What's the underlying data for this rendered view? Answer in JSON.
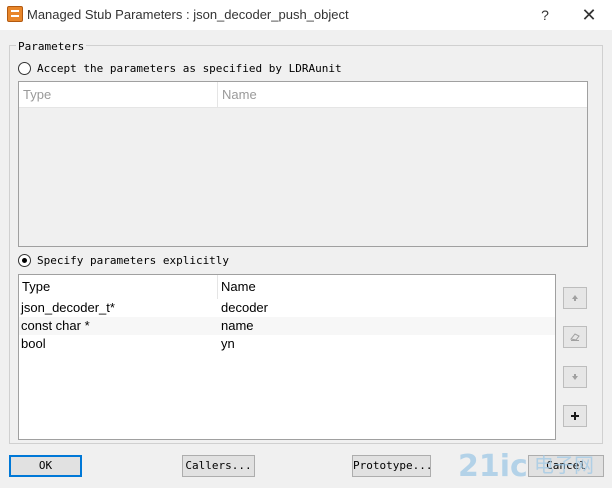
{
  "window": {
    "title": "Managed Stub Parameters : json_decoder_push_object",
    "help_label": "?",
    "close_label": "✕"
  },
  "group": {
    "label": "Parameters"
  },
  "option_accept": {
    "label": "Accept the parameters as specified by LDRAunit",
    "selected": false,
    "table": {
      "columns": [
        "Type",
        "Name"
      ],
      "rows": []
    }
  },
  "option_explicit": {
    "label": "Specify parameters explicitly",
    "selected": true,
    "table": {
      "columns": [
        "Type",
        "Name"
      ],
      "rows": [
        {
          "type": "json_decoder_t*",
          "name": "decoder"
        },
        {
          "type": "const char *",
          "name": "name"
        },
        {
          "type": "bool",
          "name": "yn"
        }
      ]
    }
  },
  "side_buttons": [
    {
      "icon": "move-up-icon"
    },
    {
      "icon": "eraser-icon"
    },
    {
      "icon": "move-down-icon"
    },
    {
      "icon": "plus-icon"
    }
  ],
  "buttons": {
    "ok": "OK",
    "callers": "Callers...",
    "prototype": "Prototype...",
    "cancel": "Cancel"
  },
  "watermark": {
    "text_latin": "21ic",
    "text_cjk": "电子网",
    "colors": {
      "accent": "#9fc8e6"
    }
  },
  "colors": {
    "focus_border": "#0078d7",
    "window_bg": "#f0f0f0",
    "app_icon": "#e8862a"
  }
}
